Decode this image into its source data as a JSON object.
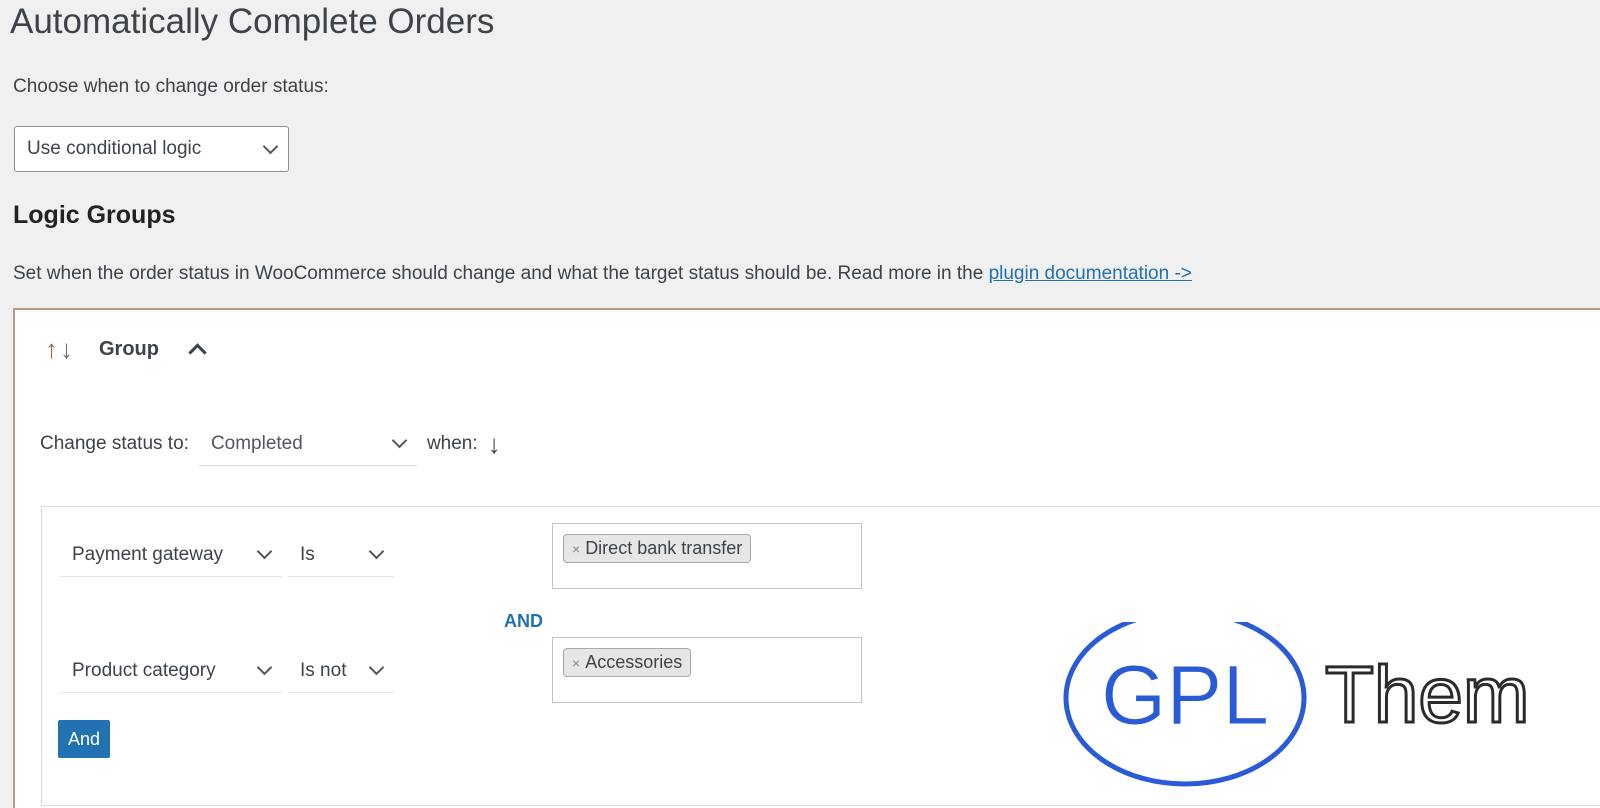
{
  "page": {
    "title": "Automatically Complete Orders",
    "choose_label": "Choose when to change order status:",
    "mode_select": {
      "value": "Use conditional logic"
    }
  },
  "logic_groups": {
    "title": "Logic Groups",
    "description": "Set when the order status in WooCommerce should change and what the target status should be. Read more in the",
    "doc_link": "plugin documentation ->"
  },
  "group": {
    "sort_up": "↑",
    "sort_down": "↓",
    "label": "Group",
    "change_status_label": "Change status to:",
    "status_value": "Completed",
    "when_label": "when:",
    "conditions": [
      {
        "field": "Payment gateway",
        "operator": "Is",
        "value_tag": "Direct bank transfer",
        "remove": "×"
      },
      {
        "field": "Product category",
        "operator": "Is not",
        "value_tag": "Accessories",
        "remove": "×"
      }
    ],
    "and_label": "AND",
    "and_button": "And"
  },
  "watermark": {
    "text_left": "GPL",
    "text_right": "Them",
    "colors": {
      "blue": "#2a5bd7",
      "dark": "#2b2b2b"
    }
  },
  "colors": {
    "accent": "#2271b1",
    "background": "#f0f0f1",
    "panel_border": "#b59a85"
  }
}
